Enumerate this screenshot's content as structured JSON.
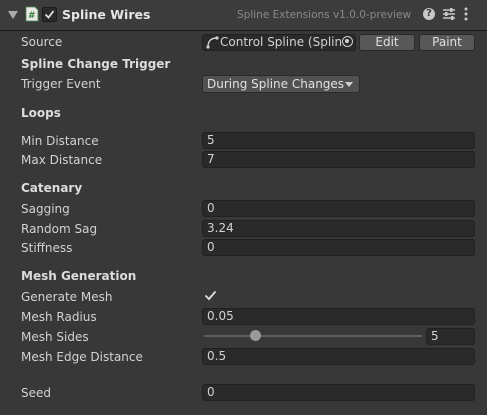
{
  "header": {
    "title": "Spline Wires",
    "version": "Spline Extensions v1.0.0-preview",
    "enabled": true,
    "icons": [
      "script-icon",
      "help-icon",
      "presets-icon",
      "context-menu-icon"
    ]
  },
  "source": {
    "label": "Source",
    "value": "Control Spline (Spline",
    "edit_label": "Edit",
    "paint_label": "Paint"
  },
  "trigger": {
    "section": "Spline Change Trigger",
    "label": "Trigger Event",
    "value": "During Spline Changes"
  },
  "loops": {
    "section": "Loops",
    "min_label": "Min Distance",
    "min_value": "5",
    "max_label": "Max Distance",
    "max_value": "7"
  },
  "catenary": {
    "section": "Catenary",
    "sagging_label": "Sagging",
    "sagging_value": "0",
    "random_label": "Random Sag",
    "random_value": "3.24",
    "stiffness_label": "Stiffness",
    "stiffness_value": "0"
  },
  "mesh": {
    "section": "Mesh Generation",
    "generate_label": "Generate Mesh",
    "generate_checked": true,
    "radius_label": "Mesh Radius",
    "radius_value": "0.05",
    "sides_label": "Mesh Sides",
    "sides_value": "5",
    "sides_slider_fraction": 0.23,
    "edge_label": "Mesh Edge Distance",
    "edge_value": "0.5"
  },
  "seed": {
    "label": "Seed",
    "value": "0"
  }
}
